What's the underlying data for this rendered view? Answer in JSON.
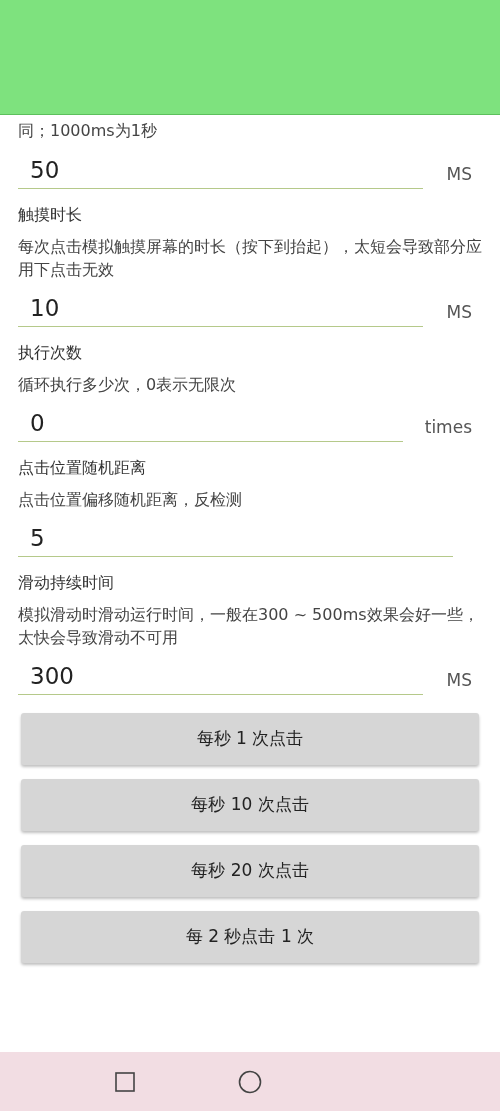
{
  "intro_text": "同；1000ms为1秒",
  "settings": [
    {
      "value": "50",
      "unit": "MS"
    },
    {
      "title": "触摸时长",
      "description": "每次点击模拟触摸屏幕的时长（按下到抬起），太短会导致部分应用下点击无效",
      "value": "10",
      "unit": "MS"
    },
    {
      "title": "执行次数",
      "description": "循环执行多少次，0表示无限次",
      "value": "0",
      "unit": "times"
    },
    {
      "title": "点击位置随机距离",
      "description": "点击位置偏移随机距离，反检测",
      "value": "5"
    },
    {
      "title": "滑动持续时间",
      "description": "模拟滑动时滑动运行时间，一般在300 ~ 500ms效果会好一些，太快会导致滑动不可用",
      "value": "300",
      "unit": "MS"
    }
  ],
  "buttons": [
    "每秒 1 次点击",
    "每秒 10 次点击",
    "每秒 20 次点击",
    "每 2 秒点击 1 次"
  ]
}
